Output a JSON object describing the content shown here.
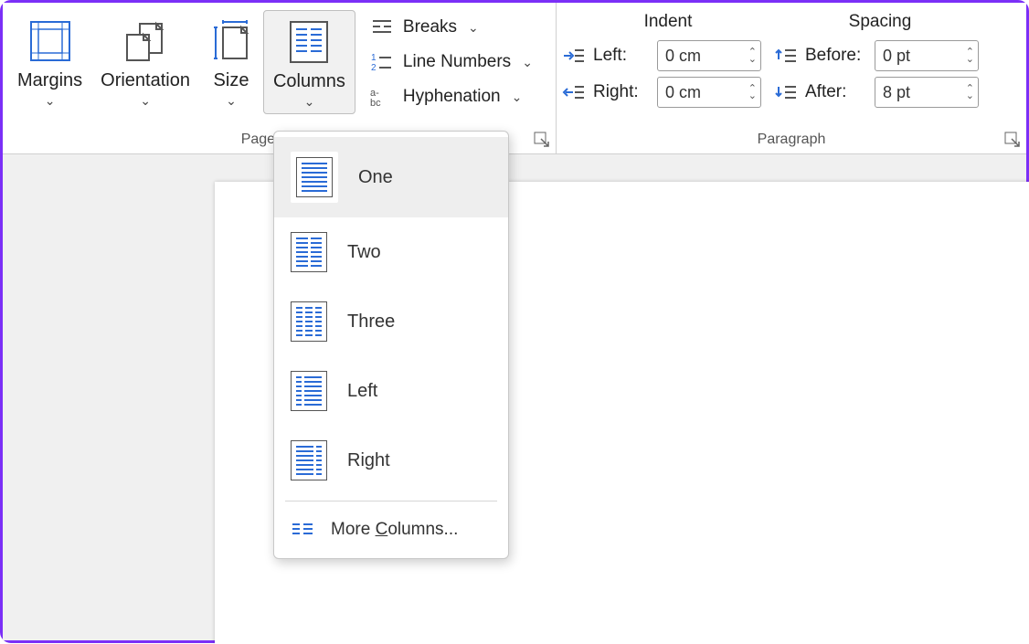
{
  "page_setup": {
    "label": "Page Setup",
    "margins": "Margins",
    "orientation": "Orientation",
    "size": "Size",
    "columns": "Columns",
    "breaks": "Breaks",
    "line_numbers": "Line Numbers",
    "hyphenation": "Hyphenation"
  },
  "paragraph": {
    "label": "Paragraph",
    "indent_head": "Indent",
    "spacing_head": "Spacing",
    "left_label": "Left:",
    "right_label": "Right:",
    "before_label": "Before:",
    "after_label": "After:",
    "left_value": "0 cm",
    "right_value": "0 cm",
    "before_value": "0 pt",
    "after_value": "8 pt"
  },
  "columns_menu": {
    "one": "One",
    "two": "Two",
    "three": "Three",
    "left": "Left",
    "right": "Right",
    "more_pre": "More ",
    "more_u": "C",
    "more_post": "olumns..."
  }
}
